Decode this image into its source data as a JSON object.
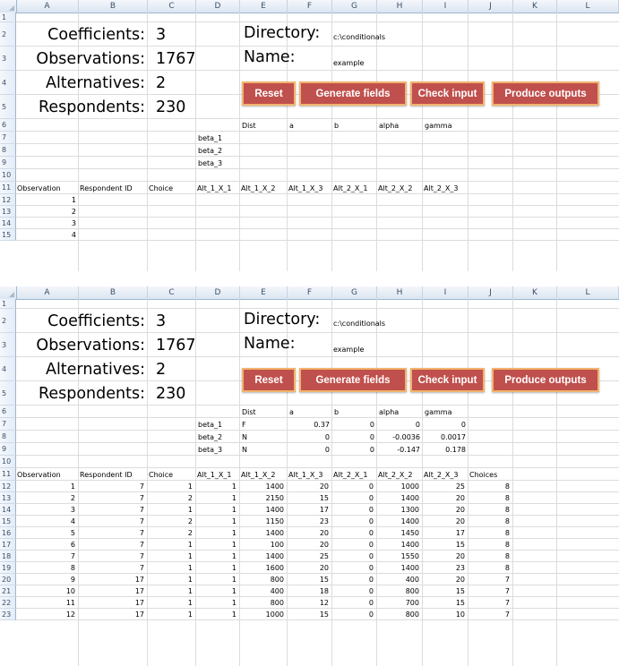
{
  "columns": [
    "A",
    "B",
    "C",
    "D",
    "E",
    "F",
    "G",
    "H",
    "I",
    "J",
    "K",
    "L"
  ],
  "labels": {
    "coefficients": "Coefficients:",
    "observations": "Observations:",
    "alternatives": "Alternatives:",
    "respondents": "Respondents:",
    "directory": "Directory:",
    "name": "Name:"
  },
  "values": {
    "coefficients": "3",
    "observations": "1767",
    "alternatives": "2",
    "respondents": "230",
    "directory": "c:\\conditionals",
    "name": "example"
  },
  "buttons": {
    "reset": "Reset",
    "generate": "Generate fields",
    "check": "Check input",
    "produce": "Produce outputs"
  },
  "dist_headers": [
    "Dist",
    "a",
    "b",
    "alpha",
    "gamma"
  ],
  "betas": [
    "beta_1",
    "beta_2",
    "beta_3"
  ],
  "table_headers": [
    "Observation",
    "Respondent ID",
    "Choice",
    "Alt_1_X_1",
    "Alt_1_X_2",
    "Alt_1_X_3",
    "Alt_2_X_1",
    "Alt_2_X_2",
    "Alt_2_X_3"
  ],
  "choices_header": "Choices",
  "top_rows": [
    "1",
    "2",
    "3",
    "4"
  ],
  "beta_params": [
    [
      "F",
      "0.37",
      "0",
      "0",
      "0"
    ],
    [
      "N",
      "0",
      "0",
      "-0.0036",
      "0.0017"
    ],
    [
      "N",
      "0",
      "0",
      "-0.147",
      "0.178"
    ]
  ],
  "bottom_rows": [
    [
      "1",
      "7",
      "1",
      "1",
      "1400",
      "20",
      "0",
      "1000",
      "25",
      "8"
    ],
    [
      "2",
      "7",
      "2",
      "1",
      "2150",
      "15",
      "0",
      "1400",
      "20",
      "8"
    ],
    [
      "3",
      "7",
      "1",
      "1",
      "1400",
      "17",
      "0",
      "1300",
      "20",
      "8"
    ],
    [
      "4",
      "7",
      "2",
      "1",
      "1150",
      "23",
      "0",
      "1400",
      "20",
      "8"
    ],
    [
      "5",
      "7",
      "2",
      "1",
      "1400",
      "20",
      "0",
      "1450",
      "17",
      "8"
    ],
    [
      "6",
      "7",
      "1",
      "1",
      "100",
      "20",
      "0",
      "1400",
      "15",
      "8"
    ],
    [
      "7",
      "7",
      "1",
      "1",
      "1400",
      "25",
      "0",
      "1550",
      "20",
      "8"
    ],
    [
      "8",
      "7",
      "1",
      "1",
      "1600",
      "20",
      "0",
      "1400",
      "23",
      "8"
    ],
    [
      "9",
      "17",
      "1",
      "1",
      "800",
      "15",
      "0",
      "400",
      "20",
      "7"
    ],
    [
      "10",
      "17",
      "1",
      "1",
      "400",
      "18",
      "0",
      "800",
      "15",
      "7"
    ],
    [
      "11",
      "17",
      "1",
      "1",
      "800",
      "12",
      "0",
      "700",
      "15",
      "7"
    ],
    [
      "12",
      "17",
      "1",
      "1",
      "1000",
      "15",
      "0",
      "800",
      "10",
      "7"
    ]
  ]
}
